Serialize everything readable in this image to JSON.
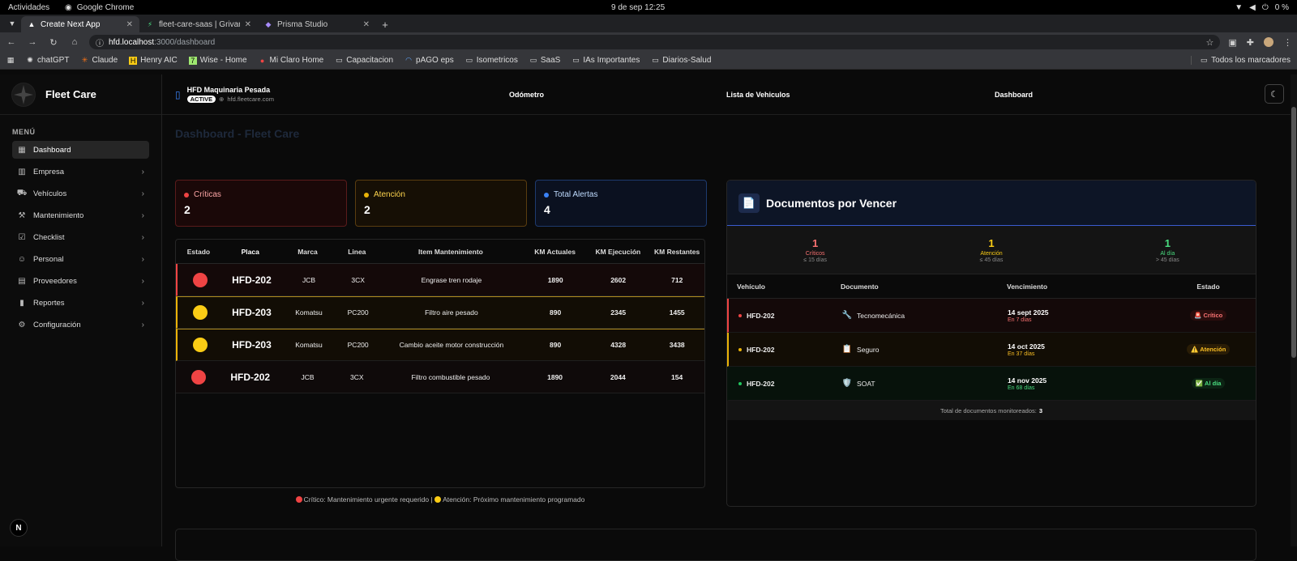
{
  "os": {
    "activities": "Actividades",
    "app_name": "Google Chrome",
    "clock": "9 de sep  12:25",
    "battery": "0 %"
  },
  "browser": {
    "tabs": [
      {
        "title": "Create Next App"
      },
      {
        "title": "fleet-care-saas | Grivarol"
      },
      {
        "title": "Prisma Studio"
      }
    ],
    "url_host": "hfd.localhost",
    "url_path": ":3000/dashboard",
    "bookmarks": [
      "chatGPT",
      "Claude",
      "Henry AIC",
      "Wise - Home",
      "Mi Claro Home",
      "Capacitacion",
      "pAGO eps",
      "Isometricos",
      "SaaS",
      "IAs Importantes",
      "Diarios-Salud"
    ],
    "all_bookmarks": "Todos los marcadores"
  },
  "sidebar": {
    "brand": "Fleet Care",
    "menu_title": "MENÚ",
    "items": [
      {
        "label": "Dashboard",
        "icon": "dashboard-icon"
      },
      {
        "label": "Empresa",
        "icon": "building-icon"
      },
      {
        "label": "Vehículos",
        "icon": "truck-icon"
      },
      {
        "label": "Mantenimiento",
        "icon": "wrench-icon"
      },
      {
        "label": "Checklist",
        "icon": "clipboard-icon"
      },
      {
        "label": "Personal",
        "icon": "user-icon"
      },
      {
        "label": "Proveedores",
        "icon": "briefcase-icon"
      },
      {
        "label": "Reportes",
        "icon": "bar-chart-icon"
      },
      {
        "label": "Configuración",
        "icon": "gear-icon"
      }
    ],
    "next_badge": "N"
  },
  "header": {
    "org_name": "HFD Maquinaria Pesada",
    "org_status": "ACTIVE",
    "org_domain": "hfd.fleetcare.com",
    "nav": [
      "Odómetro",
      "Lista de Vehiculos",
      "Dashboard"
    ]
  },
  "page": {
    "title": "Dashboard - Fleet Care"
  },
  "alert_cards": [
    {
      "label": "Críticas",
      "value": "2",
      "color": "#ef4444",
      "text_color": "#fca5a5"
    },
    {
      "label": "Atención",
      "value": "2",
      "color": "#eab308",
      "text_color": "#fcd34d"
    },
    {
      "label": "Total Alertas",
      "value": "4",
      "color": "#3b82f6",
      "text_color": "#bfdbfe"
    }
  ],
  "maintenance": {
    "headers": [
      "Estado",
      "Placa",
      "Marca",
      "Linea",
      "Item Mantenimiento",
      "KM Actuales",
      "KM Ejecución",
      "KM Restantes"
    ],
    "rows": [
      {
        "status": "critical",
        "placa": "HFD-202",
        "marca": "JCB",
        "linea": "3CX",
        "item": "Engrase tren rodaje",
        "km_actuales": "1890",
        "km_ejecucion": "2602",
        "km_restantes": "712"
      },
      {
        "status": "warning",
        "placa": "HFD-203",
        "marca": "Komatsu",
        "linea": "PC200",
        "item": "Filtro aire pesado",
        "km_actuales": "890",
        "km_ejecucion": "2345",
        "km_restantes": "1455"
      },
      {
        "status": "warning",
        "placa": "HFD-203",
        "marca": "Komatsu",
        "linea": "PC200",
        "item": "Cambio aceite motor construcción",
        "km_actuales": "890",
        "km_ejecucion": "4328",
        "km_restantes": "3438"
      },
      {
        "status": "critical",
        "placa": "HFD-202",
        "marca": "JCB",
        "linea": "3CX",
        "item": "Filtro combustible pesado",
        "km_actuales": "1890",
        "km_ejecucion": "2044",
        "km_restantes": "154"
      }
    ],
    "legend_critical": "Crítico: Mantenimiento urgente requerido | ",
    "legend_warning": "Atención: Próximo mantenimiento programado"
  },
  "documents": {
    "title": "Documentos por Vencer",
    "summary": [
      {
        "value": "1",
        "label": "Críticos",
        "range": "≤ 15 días",
        "color": "#f87171"
      },
      {
        "value": "1",
        "label": "Atención",
        "range": "≤ 45 días",
        "color": "#facc15"
      },
      {
        "value": "1",
        "label": "Al día",
        "range": "> 45 días",
        "color": "#4ade80"
      }
    ],
    "headers": [
      "Vehículo",
      "Documento",
      "Vencimiento",
      "Estado"
    ],
    "rows": [
      {
        "status": "critical",
        "vehiculo": "HFD-202",
        "icon": "🔧",
        "documento": "Tecnomecánica",
        "fecha": "14 sept 2025",
        "restante": "En 7 días",
        "estado": "🚨 Crítico"
      },
      {
        "status": "warning",
        "vehiculo": "HFD-202",
        "icon": "📋",
        "documento": "Seguro",
        "fecha": "14 oct 2025",
        "restante": "En 37 días",
        "estado": "⚠️ Atención"
      },
      {
        "status": "ok",
        "vehiculo": "HFD-202",
        "icon": "🛡️",
        "documento": "SOAT",
        "fecha": "14 nov 2025",
        "restante": "En 68 días",
        "estado": "✅ Al día"
      }
    ],
    "footer_label": "Total de documentos monitoreados:",
    "footer_count": "3"
  },
  "colors": {
    "critical": "#ef4444",
    "warning": "#eab308",
    "ok": "#22c55e",
    "accent": "#3b82f6"
  }
}
